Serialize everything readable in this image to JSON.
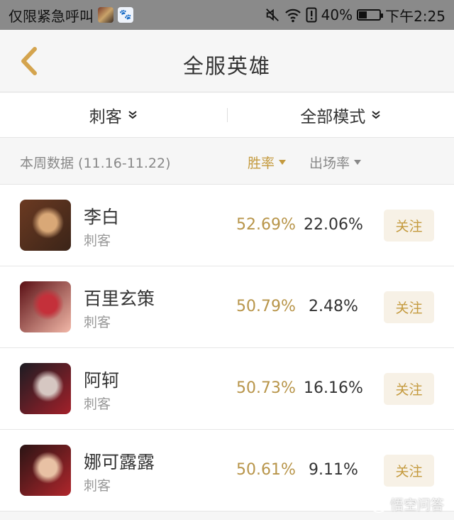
{
  "status_bar": {
    "notification_text": "仅限紧急呼叫",
    "battery": "40%",
    "battery_level": 0.4,
    "time": "下午2:25",
    "icons": [
      "game-app-icon",
      "baidu-paw-icon",
      "mute-icon",
      "wifi-icon",
      "sim-alert-icon",
      "battery-icon"
    ]
  },
  "nav": {
    "back_icon": "chevron-left-icon",
    "title": "全服英雄"
  },
  "filters": {
    "role": "刺客",
    "mode": "全部模式"
  },
  "stats_header": {
    "week_label": "本周数据 (11.16-11.22)",
    "win_rate_label": "胜率",
    "pick_rate_label": "出场率"
  },
  "heroes": [
    {
      "name": "李白",
      "role": "刺客",
      "win_rate": "52.69%",
      "pick_rate": "22.06%",
      "follow": "关注",
      "avatar_colors": [
        "#6b3a22",
        "#d9a877",
        "#3b2418"
      ]
    },
    {
      "name": "百里玄策",
      "role": "刺客",
      "win_rate": "50.79%",
      "pick_rate": "2.48%",
      "follow": "关注",
      "avatar_colors": [
        "#5a0f14",
        "#c4303a",
        "#f2b8a8"
      ]
    },
    {
      "name": "阿轲",
      "role": "刺客",
      "win_rate": "50.73%",
      "pick_rate": "16.16%",
      "follow": "关注",
      "avatar_colors": [
        "#1c1c22",
        "#d6c7c2",
        "#a3202a"
      ]
    },
    {
      "name": "娜可露露",
      "role": "刺客",
      "win_rate": "50.61%",
      "pick_rate": "9.11%",
      "follow": "关注",
      "avatar_colors": [
        "#2a1414",
        "#e8c1a4",
        "#b0262c"
      ]
    }
  ],
  "watermark": "悟空问答",
  "colors": {
    "accent_gold": "#c49a3e",
    "win_rate": "#b8954a",
    "follow_bg": "#f7f1e6"
  }
}
